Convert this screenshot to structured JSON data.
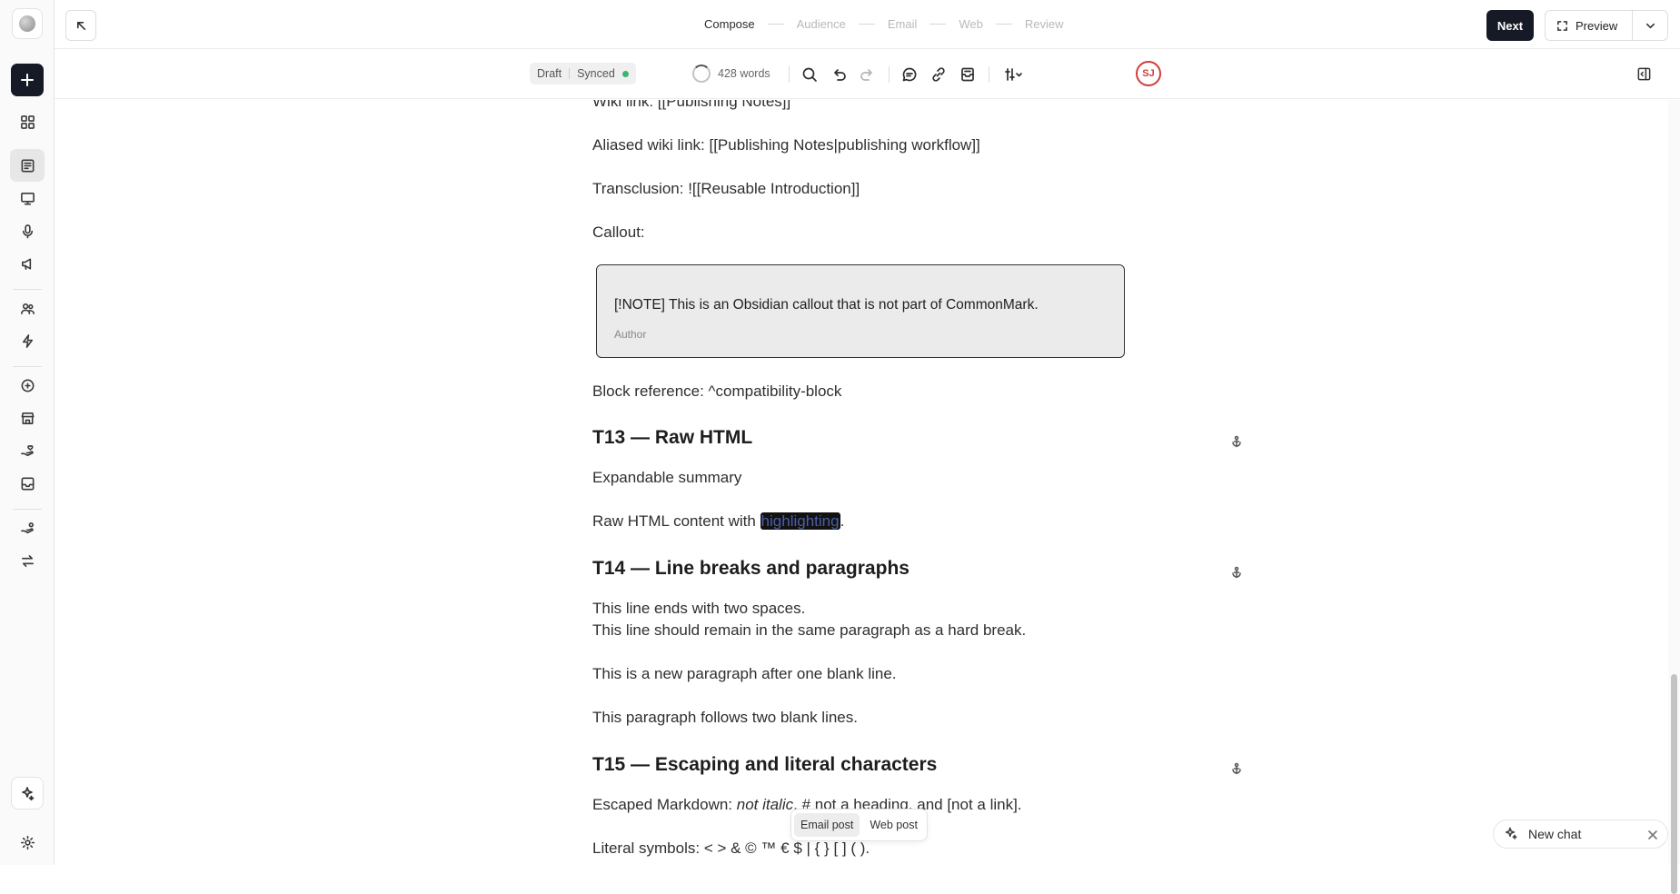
{
  "header": {
    "steps": [
      {
        "label": "Compose",
        "active": true
      },
      {
        "label": "Audience",
        "active": false
      },
      {
        "label": "Email",
        "active": false
      },
      {
        "label": "Web",
        "active": false
      },
      {
        "label": "Review",
        "active": false
      }
    ],
    "next_label": "Next",
    "preview_label": "Preview"
  },
  "toolbar": {
    "status_draft": "Draft",
    "status_synced": "Synced",
    "word_count": "428 words",
    "avatar_initials": "SJ"
  },
  "doc": {
    "wiki_link": "Wiki link: [[Publishing Notes]]",
    "aliased_wiki_link": "Aliased wiki link: [[Publishing Notes|publishing workflow]]",
    "transclusion": "Transclusion: ![[Reusable Introduction]]",
    "callout_label": "Callout:",
    "callout_text": "[!NOTE] This is an Obsidian callout that is not part of CommonMark.",
    "callout_author": "Author",
    "block_reference": "Block reference: ^compatibility-block",
    "h_t13": "T13 — Raw HTML",
    "expandable_summary": "Expandable summary",
    "raw_html_prefix": "Raw HTML content with ",
    "raw_html_highlight": "highlighting",
    "raw_html_suffix": ".",
    "h_t14": "T14 — Line breaks and paragraphs",
    "line1": "This line ends with two spaces.",
    "line2": "This line should remain in the same paragraph as a hard break.",
    "new_paragraph": "This is a new paragraph after one blank line.",
    "two_blank": "This paragraph follows two blank lines.",
    "h_t15": "T15 — Escaping and literal characters",
    "escaped_prefix": "Escaped Markdown: ",
    "escaped_italic": "not italic",
    "escaped_suffix": ", # not a heading, and [not a link].",
    "literal_symbols": "Literal symbols: < > & © ™ € $ | { } [ ] ( )."
  },
  "post_tabs": [
    {
      "label": "Email post",
      "active": true
    },
    {
      "label": "Web post",
      "active": false
    }
  ],
  "new_chat_label": "New chat"
}
